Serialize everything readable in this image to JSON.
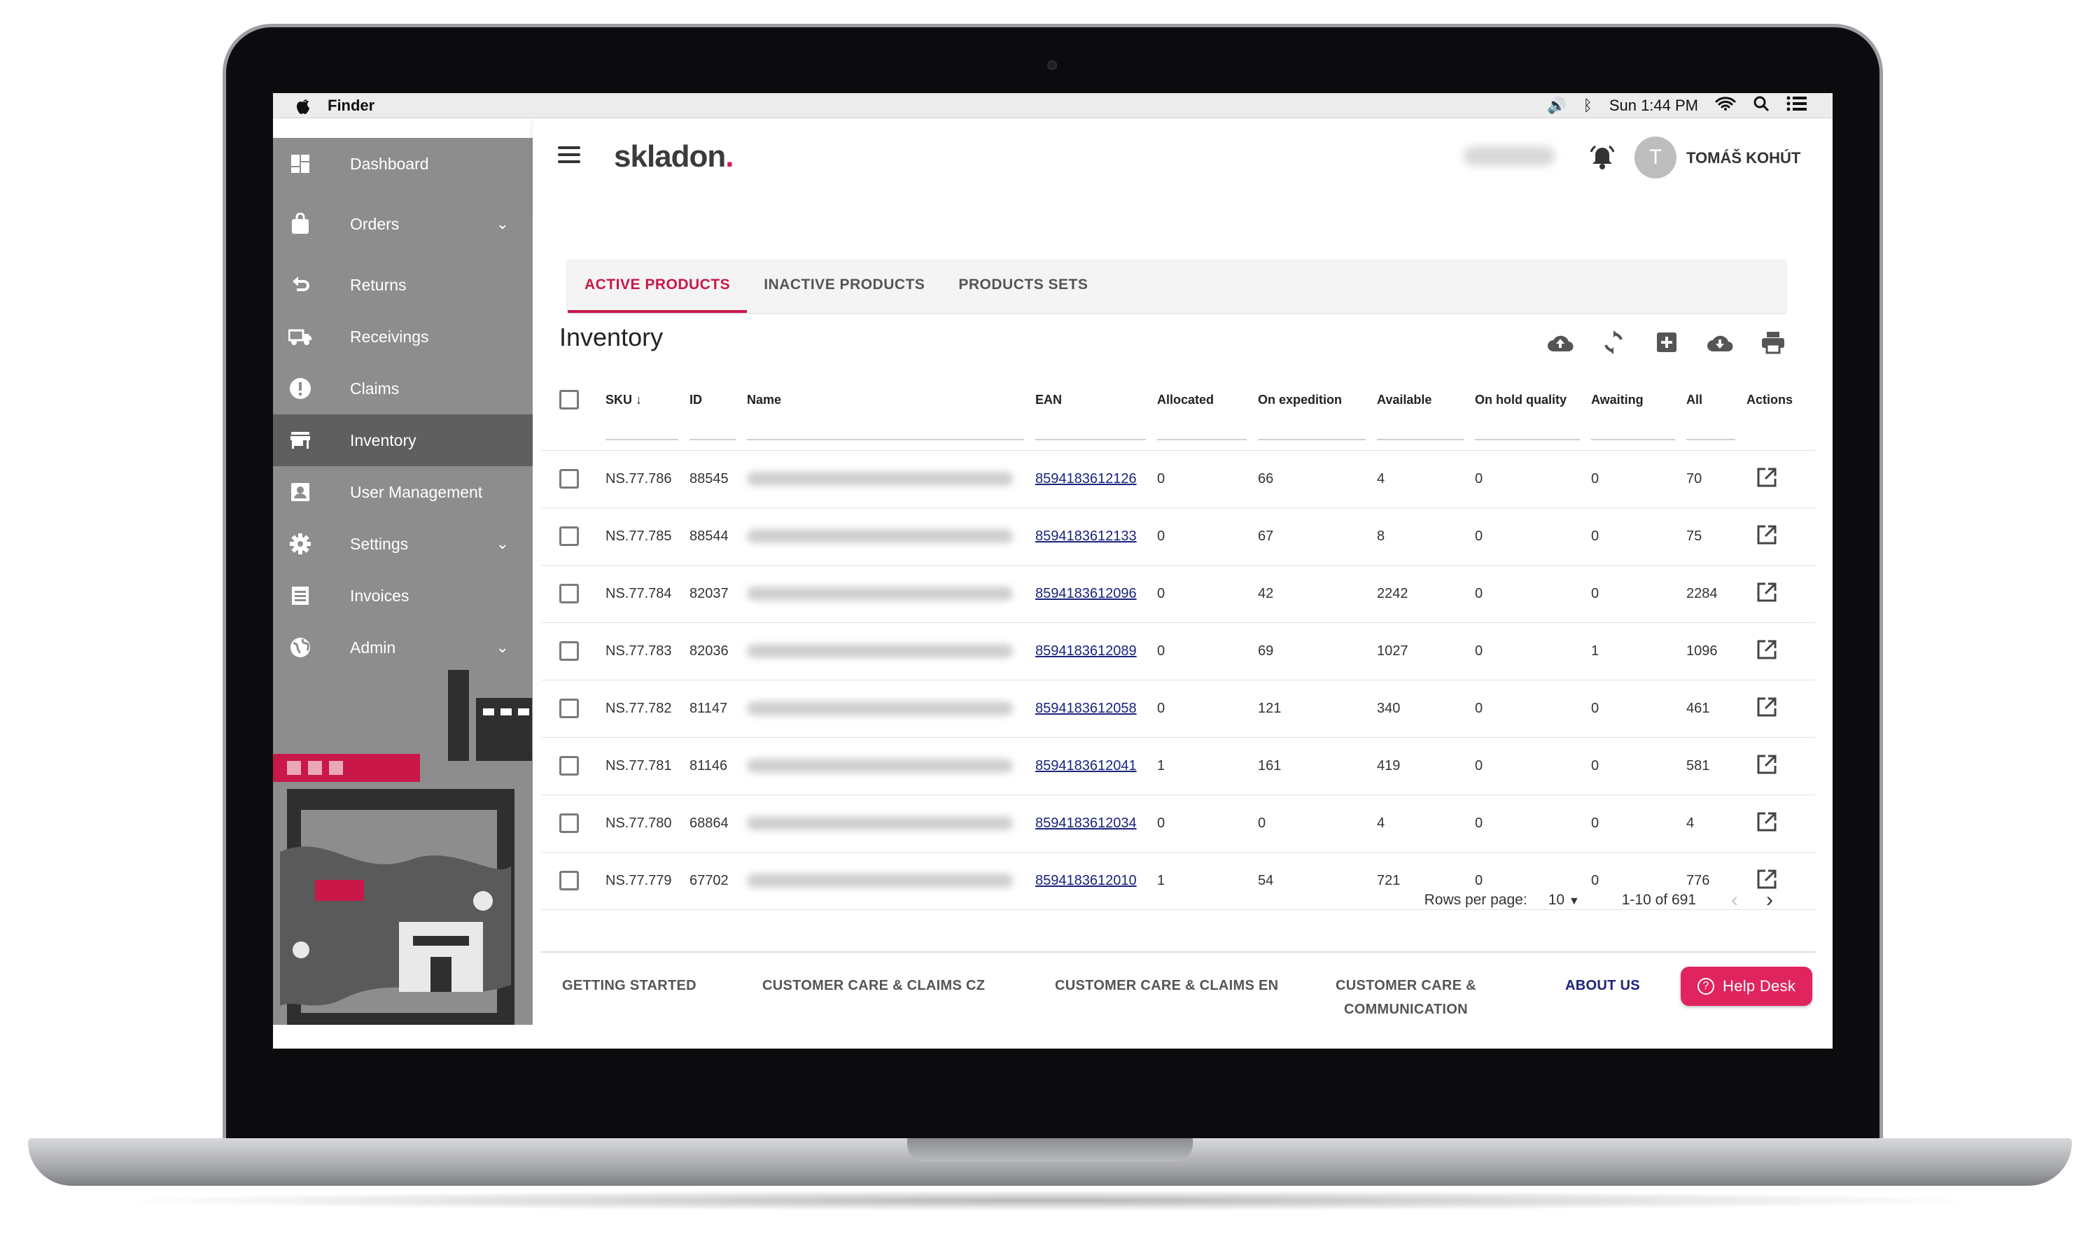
{
  "menubar": {
    "app_name": "Finder",
    "clock": "Sun 1:44 PM"
  },
  "sidebar": {
    "items": [
      {
        "label": "Dashboard",
        "icon": "dashboard-icon"
      },
      {
        "label": "Orders",
        "icon": "bag-icon",
        "expandable": true
      },
      {
        "label": "Returns",
        "icon": "returns-icon"
      },
      {
        "label": "Receivings",
        "icon": "truck-icon"
      },
      {
        "label": "Claims",
        "icon": "alert-icon"
      },
      {
        "label": "Inventory",
        "icon": "store-icon",
        "active": true
      },
      {
        "label": "User Management",
        "icon": "contact-icon"
      },
      {
        "label": "Settings",
        "icon": "gear-icon",
        "expandable": true
      },
      {
        "label": "Invoices",
        "icon": "list-icon"
      },
      {
        "label": "Admin",
        "icon": "globe-icon",
        "expandable": true
      }
    ]
  },
  "header": {
    "logo_text": "skladon",
    "logo_dot": ".",
    "avatar_initial": "T",
    "user_name": "TOMÁŠ KOHÚT"
  },
  "tabs": [
    {
      "label": "ACTIVE PRODUCTS",
      "active": true
    },
    {
      "label": "INACTIVE PRODUCTS",
      "active": false
    },
    {
      "label": "PRODUCTS SETS",
      "active": false
    }
  ],
  "inventory": {
    "title": "Inventory",
    "columns": {
      "sku": "SKU",
      "id": "ID",
      "name": "Name",
      "ean": "EAN",
      "allocated": "Allocated",
      "on_expedition": "On expedition",
      "available": "Available",
      "on_hold": "On hold quality",
      "awaiting": "Awaiting",
      "all": "All",
      "actions": "Actions"
    },
    "rows": [
      {
        "sku": "NS.77.786",
        "id": "88545",
        "ean": "8594183612126",
        "allocated": "0",
        "on_expedition": "66",
        "available": "4",
        "on_hold": "0",
        "awaiting": "0",
        "all": "70"
      },
      {
        "sku": "NS.77.785",
        "id": "88544",
        "ean": "8594183612133",
        "allocated": "0",
        "on_expedition": "67",
        "available": "8",
        "on_hold": "0",
        "awaiting": "0",
        "all": "75"
      },
      {
        "sku": "NS.77.784",
        "id": "82037",
        "ean": "8594183612096",
        "allocated": "0",
        "on_expedition": "42",
        "available": "2242",
        "on_hold": "0",
        "awaiting": "0",
        "all": "2284"
      },
      {
        "sku": "NS.77.783",
        "id": "82036",
        "ean": "8594183612089",
        "allocated": "0",
        "on_expedition": "69",
        "available": "1027",
        "on_hold": "0",
        "awaiting": "1",
        "all": "1096"
      },
      {
        "sku": "NS.77.782",
        "id": "81147",
        "ean": "8594183612058",
        "allocated": "0",
        "on_expedition": "121",
        "available": "340",
        "on_hold": "0",
        "awaiting": "0",
        "all": "461"
      },
      {
        "sku": "NS.77.781",
        "id": "81146",
        "ean": "8594183612041",
        "allocated": "1",
        "on_expedition": "161",
        "available": "419",
        "on_hold": "0",
        "awaiting": "0",
        "all": "581"
      },
      {
        "sku": "NS.77.780",
        "id": "68864",
        "ean": "8594183612034",
        "allocated": "0",
        "on_expedition": "0",
        "available": "4",
        "on_hold": "0",
        "awaiting": "0",
        "all": "4"
      },
      {
        "sku": "NS.77.779",
        "id": "67702",
        "ean": "8594183612010",
        "allocated": "1",
        "on_expedition": "54",
        "available": "721",
        "on_hold": "0",
        "awaiting": "0",
        "all": "776"
      }
    ],
    "pagination": {
      "rows_per_page_label": "Rows per page:",
      "rows_per_page_value": "10",
      "range_text": "1-10 of 691"
    }
  },
  "footer": {
    "getting_started": "GETTING STARTED",
    "care_cz": "CUSTOMER CARE & CLAIMS CZ",
    "care_en": "CUSTOMER CARE & CLAIMS EN",
    "care_comm_line1": "CUSTOMER CARE &",
    "care_comm_line2": "COMMUNICATION",
    "about_us": "ABOUT US",
    "help_desk": "Help Desk"
  },
  "colors": {
    "accent": "#c9174a",
    "help_button": "#e0245e",
    "link": "#1a237e",
    "sidebar_bg": "#8d8d8d",
    "sidebar_active": "#5f5f5f"
  }
}
